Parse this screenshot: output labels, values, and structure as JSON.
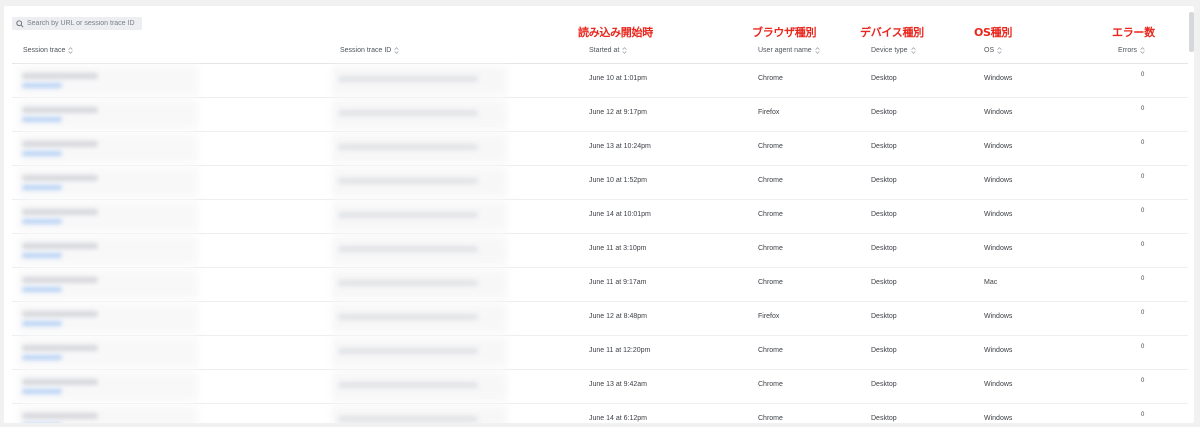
{
  "search": {
    "placeholder": "Search by URL or session trace ID"
  },
  "annotations": {
    "started_at": "読み込み開始時",
    "user_agent": "ブラウザ種別",
    "device_type": "デバイス種別",
    "os": "OS種別",
    "errors": "エラー数"
  },
  "columns": {
    "session_trace": "Session trace",
    "session_trace_id": "Session trace ID",
    "started_at": "Started at",
    "user_agent_name": "User agent name",
    "device_type": "Device type",
    "os": "OS",
    "errors": "Errors"
  },
  "rows": [
    {
      "started_at": "June 10 at 1:01pm",
      "user_agent": "Chrome",
      "device": "Desktop",
      "os": "Windows",
      "errors": "0"
    },
    {
      "started_at": "June 12 at 9:17pm",
      "user_agent": "Firefox",
      "device": "Desktop",
      "os": "Windows",
      "errors": "0"
    },
    {
      "started_at": "June 13 at 10:24pm",
      "user_agent": "Chrome",
      "device": "Desktop",
      "os": "Windows",
      "errors": "0"
    },
    {
      "started_at": "June 10 at 1:52pm",
      "user_agent": "Chrome",
      "device": "Desktop",
      "os": "Windows",
      "errors": "0"
    },
    {
      "started_at": "June 14 at 10:01pm",
      "user_agent": "Chrome",
      "device": "Desktop",
      "os": "Windows",
      "errors": "0"
    },
    {
      "started_at": "June 11 at 3:10pm",
      "user_agent": "Chrome",
      "device": "Desktop",
      "os": "Windows",
      "errors": "0"
    },
    {
      "started_at": "June 11 at 9:17am",
      "user_agent": "Chrome",
      "device": "Desktop",
      "os": "Mac",
      "errors": "0"
    },
    {
      "started_at": "June 12 at 8:48pm",
      "user_agent": "Firefox",
      "device": "Desktop",
      "os": "Windows",
      "errors": "0"
    },
    {
      "started_at": "June 11 at 12:20pm",
      "user_agent": "Chrome",
      "device": "Desktop",
      "os": "Windows",
      "errors": "0"
    },
    {
      "started_at": "June 13 at 9:42am",
      "user_agent": "Chrome",
      "device": "Desktop",
      "os": "Windows",
      "errors": "0"
    },
    {
      "started_at": "June 14 at 6:12pm",
      "user_agent": "Chrome",
      "device": "Desktop",
      "os": "Windows",
      "errors": "0"
    }
  ],
  "icons": {
    "search": "search-icon",
    "sort": "sort-icon"
  },
  "colors": {
    "annotation": "#e8261c",
    "link_blur": "#b9d3f5"
  }
}
